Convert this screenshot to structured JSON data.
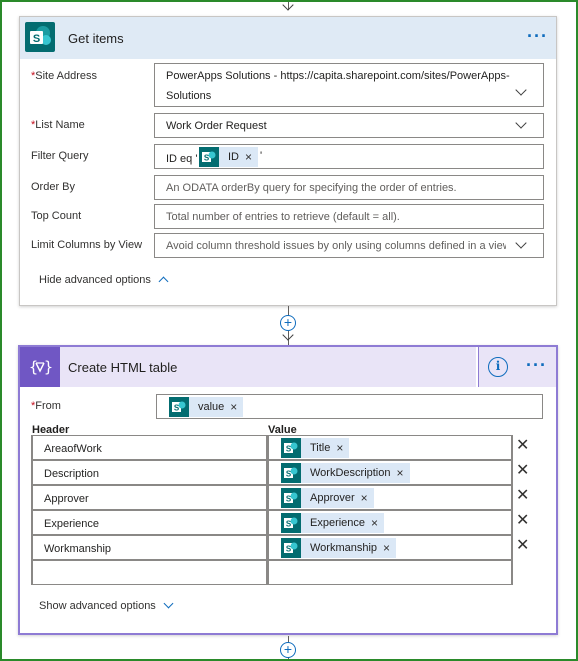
{
  "get_items": {
    "title": "Get items",
    "menu": "···",
    "site_address": {
      "label": "Site Address",
      "required": "*",
      "value_line1": "PowerApps Solutions - https://capita.sharepoint.com/sites/PowerApps-",
      "value_line2": "Solutions"
    },
    "list_name": {
      "label": "List Name",
      "required": "*",
      "value": "Work Order Request"
    },
    "filter_query": {
      "label": "Filter Query",
      "prefix": "ID eq '",
      "token": "ID",
      "token_close": "×",
      "suffix": "'"
    },
    "order_by": {
      "label": "Order By",
      "placeholder": "An ODATA orderBy query for specifying the order of entries."
    },
    "top_count": {
      "label": "Top Count",
      "placeholder": "Total number of entries to retrieve (default = all)."
    },
    "limit_columns": {
      "label": "Limit Columns by View",
      "placeholder": "Avoid column threshold issues by only using columns defined in a view"
    },
    "advanced_toggle": "Hide advanced options"
  },
  "create_html": {
    "title": "Create HTML table",
    "menu": "···",
    "info": "i",
    "from": {
      "label": "From",
      "required": "*",
      "token": "value",
      "token_close": "×"
    },
    "header_col": "Header",
    "value_col": "Value",
    "rows": [
      {
        "header": "AreaofWork",
        "value": "Title"
      },
      {
        "header": "Description",
        "value": "WorkDescription"
      },
      {
        "header": "Approver",
        "value": "Approver"
      },
      {
        "header": "Experience",
        "value": "Experience"
      },
      {
        "header": "Workmanship",
        "value": "Workmanship"
      }
    ],
    "token_close": "×",
    "row_delete": "✕",
    "advanced_toggle": "Show advanced options"
  },
  "connector": {
    "plus": "+"
  },
  "colors": {
    "sharepoint": "#036c70",
    "accent": "#0f6cbd",
    "sp_header": "#dfeaf5",
    "html_header": "#e9e4f7",
    "html_icon": "#7057c4",
    "border_green": "#2a8a2a"
  }
}
